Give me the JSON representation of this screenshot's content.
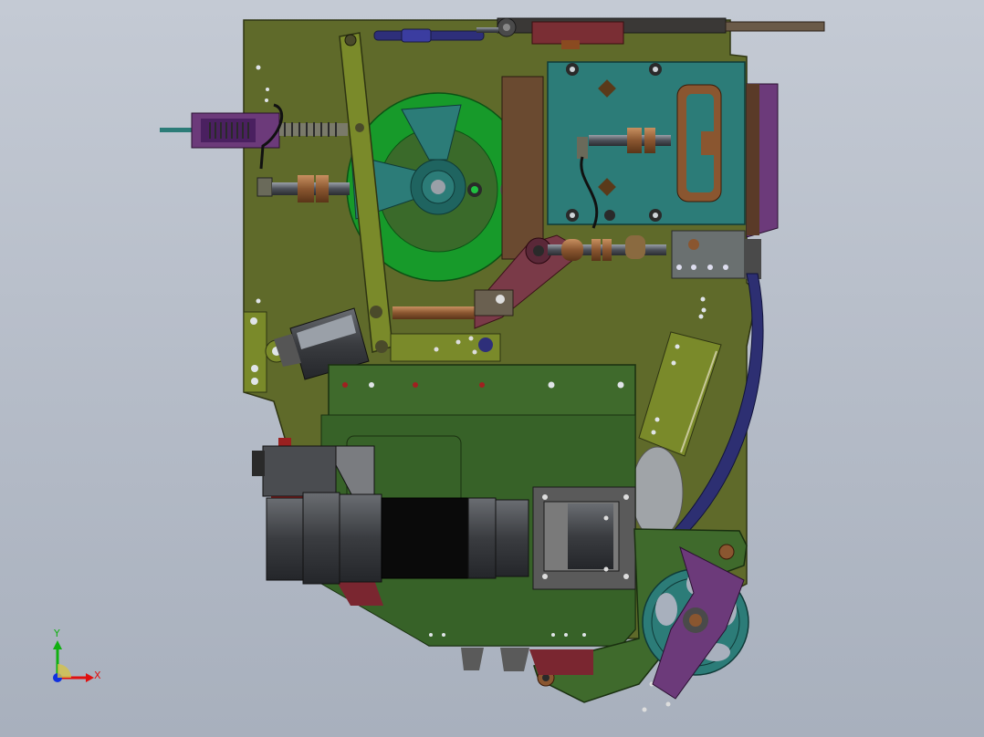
{
  "viewport": {
    "background_top": "#c4cad4",
    "background_bottom": "#a8b0bd"
  },
  "triad": {
    "x_label": "X",
    "y_label": "Y",
    "x_color": "#e01010",
    "y_color": "#10b010",
    "z_color": "#1030e0"
  },
  "colors": {
    "base_plate": "#5f6a2a",
    "lower_plate": "#3f6a2c",
    "green_disc": "#179a2a",
    "teal_part": "#2c7c78",
    "purple_part": "#6c3a7a",
    "navy_arc": "#2d2f72",
    "olive_lever": "#7a8a2a",
    "motor_dark": "#3a3c40",
    "motor_black": "#0a0a0a",
    "maroon_link": "#7a3a48",
    "red_block": "#7a2630"
  }
}
